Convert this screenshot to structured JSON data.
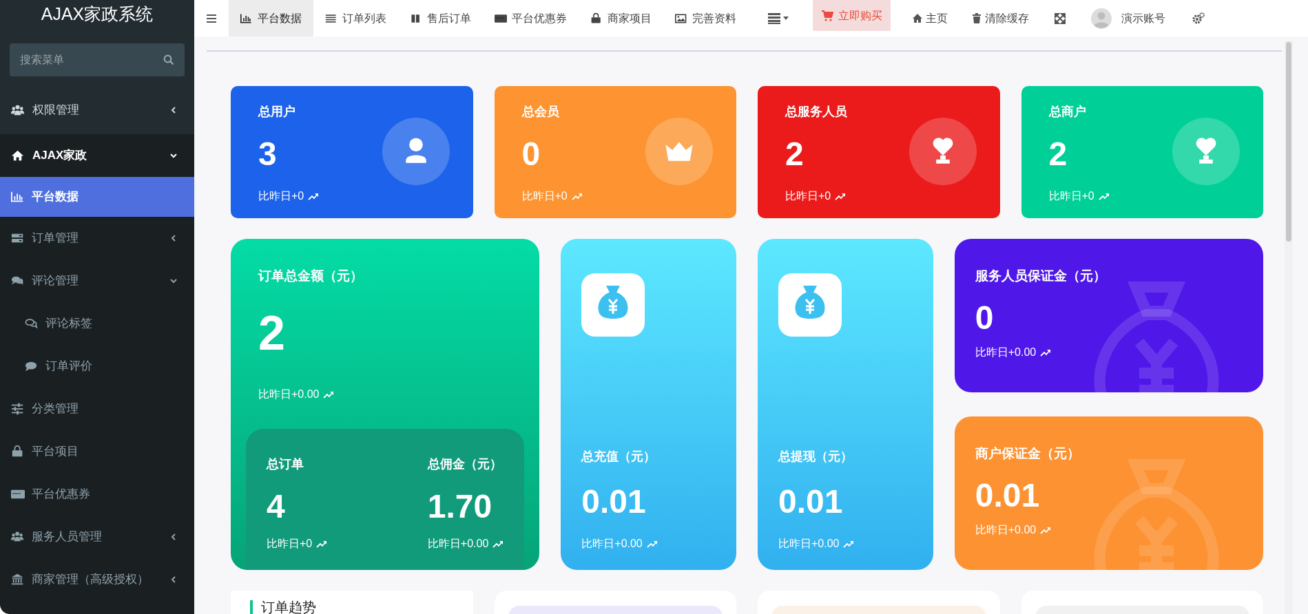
{
  "sidebar": {
    "title": "AJAX家政系统",
    "search": {
      "placeholder": "搜索菜单"
    },
    "items": [
      {
        "label": "权限管理",
        "expanded": false,
        "selected": false
      },
      {
        "label": "AJAX家政",
        "expanded": true,
        "selected": false,
        "children": [
          {
            "label": "平台数据",
            "selected": true
          },
          {
            "label": "订单管理",
            "expanded": false,
            "selected": false
          },
          {
            "label": "评论管理",
            "expanded": true,
            "selected": false,
            "children": [
              {
                "label": "评论标签",
                "selected": false
              },
              {
                "label": "订单评价",
                "selected": false
              }
            ]
          },
          {
            "label": "分类管理",
            "selected": false
          },
          {
            "label": "平台项目",
            "selected": false
          },
          {
            "label": "平台优惠券",
            "selected": false
          },
          {
            "label": "服务人员管理",
            "expanded": false,
            "selected": false
          },
          {
            "label": "商家管理（高级授权）",
            "expanded": false,
            "selected": false
          }
        ]
      }
    ]
  },
  "topbar": {
    "tabs": [
      {
        "label": "平台数据",
        "selected": true
      },
      {
        "label": "订单列表",
        "selected": false
      },
      {
        "label": "售后订单",
        "selected": false
      },
      {
        "label": "平台优惠券",
        "selected": false
      },
      {
        "label": "商家项目",
        "selected": false
      },
      {
        "label": "完善资料",
        "selected": false
      }
    ],
    "buy_button": "立即购买",
    "links": [
      "主页",
      "清除缓存"
    ],
    "user": "演示账号"
  },
  "stat_cards": [
    {
      "label": "总用户",
      "value": "3",
      "change": "比昨日+0",
      "color": "#1c62ea"
    },
    {
      "label": "总会员",
      "value": "0",
      "change": "比昨日+0",
      "color": "#fd9431"
    },
    {
      "label": "总服务人员",
      "value": "2",
      "change": "比昨日+0",
      "color": "#eb1b1b"
    },
    {
      "label": "总商户",
      "value": "2",
      "change": "比昨日+0",
      "color": "#00d097"
    }
  ],
  "order_card": {
    "title": "订单总金额（元）",
    "value": "2",
    "change": "比昨日+0.00",
    "sub_stats": [
      {
        "label": "总订单",
        "value": "4",
        "change": "比昨日+0"
      },
      {
        "label": "总佣金（元）",
        "value": "1.70",
        "change": "比昨日+0.00"
      }
    ]
  },
  "balance_cards": [
    {
      "label": "总充值（元）",
      "value": "0.01",
      "change": "比昨日+0.00"
    },
    {
      "label": "总提现（元）",
      "value": "0.01",
      "change": "比昨日+0.00"
    }
  ],
  "deposit_cards": [
    {
      "label": "服务人员保证金（元）",
      "value": "0",
      "change": "比昨日+0.00",
      "color": "#5018e8"
    },
    {
      "label": "商户保证金（元）",
      "value": "0.01",
      "change": "比昨日+0.00",
      "color": "#fd9233"
    }
  ],
  "panels": [
    {
      "title": "订单趋势"
    }
  ]
}
